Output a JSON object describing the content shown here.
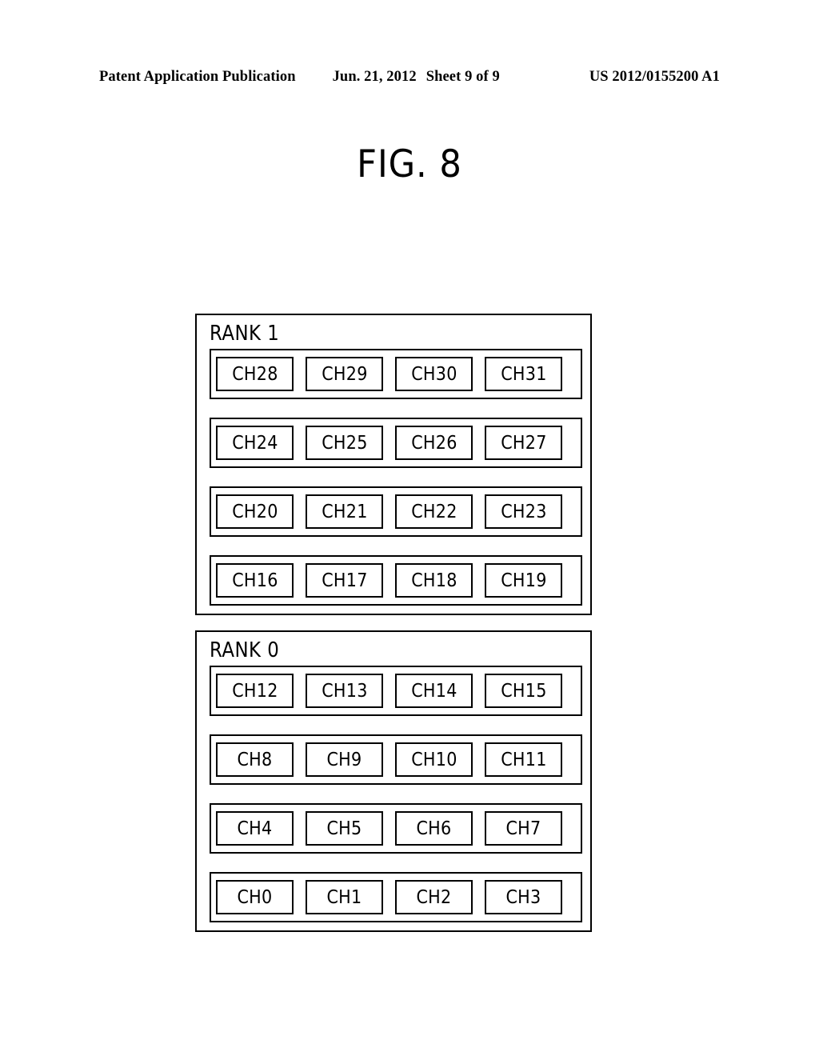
{
  "page_header": {
    "publication": "Patent Application Publication",
    "date": "Jun. 21, 2012",
    "sheet": "Sheet 9 of 9",
    "patent_number": "US 2012/0155200 A1"
  },
  "figure": {
    "title": "FIG. 8",
    "colors": {
      "line": "#000000",
      "background": "#ffffff"
    },
    "ranks": [
      {
        "label": "RANK 1",
        "rows": [
          {
            "channels": [
              "CH28",
              "CH29",
              "CH30",
              "CH31"
            ]
          },
          {
            "channels": [
              "CH24",
              "CH25",
              "CH26",
              "CH27"
            ]
          },
          {
            "channels": [
              "CH20",
              "CH21",
              "CH22",
              "CH23"
            ]
          },
          {
            "channels": [
              "CH16",
              "CH17",
              "CH18",
              "CH19"
            ]
          }
        ]
      },
      {
        "label": "RANK 0",
        "rows": [
          {
            "channels": [
              "CH12",
              "CH13",
              "CH14",
              "CH15"
            ]
          },
          {
            "channels": [
              "CH8",
              "CH9",
              "CH10",
              "CH11"
            ]
          },
          {
            "channels": [
              "CH4",
              "CH5",
              "CH6",
              "CH7"
            ]
          },
          {
            "channels": [
              "CH0",
              "CH1",
              "CH2",
              "CH3"
            ]
          }
        ]
      }
    ]
  }
}
